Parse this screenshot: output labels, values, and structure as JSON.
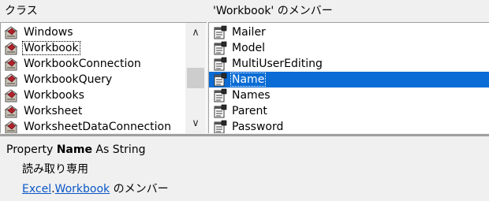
{
  "classes_pane": {
    "header": "クラス",
    "items": [
      {
        "label": "Windows",
        "icon": "class-icon"
      },
      {
        "label": "Workbook",
        "icon": "class-icon",
        "focused": true
      },
      {
        "label": "WorkbookConnection",
        "icon": "class-icon"
      },
      {
        "label": "WorkbookQuery",
        "icon": "class-icon"
      },
      {
        "label": "Workbooks",
        "icon": "class-icon"
      },
      {
        "label": "Worksheet",
        "icon": "class-icon"
      },
      {
        "label": "WorksheetDataConnection",
        "icon": "class-icon"
      }
    ],
    "scroll_up": "∧",
    "scroll_down": "∨"
  },
  "members_pane": {
    "header": "'Workbook' のメンバー",
    "items": [
      {
        "label": "Mailer",
        "icon": "property-icon"
      },
      {
        "label": "Model",
        "icon": "property-icon"
      },
      {
        "label": "MultiUserEditing",
        "icon": "property-icon"
      },
      {
        "label": "Name",
        "icon": "property-icon",
        "selected": true
      },
      {
        "label": "Names",
        "icon": "property-icon"
      },
      {
        "label": "Parent",
        "icon": "property-icon"
      },
      {
        "label": "Password",
        "icon": "property-icon"
      }
    ]
  },
  "details": {
    "line1_prefix": "Property ",
    "line1_name": "Name",
    "line1_suffix": " As String",
    "line2": "読み取り専用",
    "line3_library": "Excel",
    "line3_dot": ".",
    "line3_class": "Workbook",
    "line3_suffix": " のメンバー"
  },
  "colors": {
    "selection": "#0a6cd4",
    "link": "#0b57c6"
  }
}
